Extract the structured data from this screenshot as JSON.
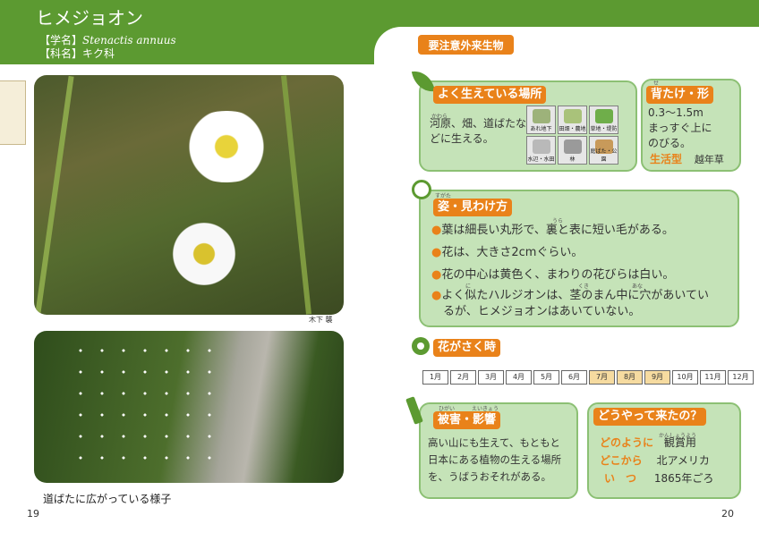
{
  "header": {
    "title": "ヒメジョオン",
    "sci_label": "【学名】",
    "sci_name": "Stenactis annuus",
    "family_label": "【科名】",
    "family_name": "キク科"
  },
  "left": {
    "photo_credit": "木下 襲",
    "caption": "道ばたに広がっている様子",
    "page_number": "19"
  },
  "right": {
    "page_number": "20",
    "badge": "要注意外来生物",
    "habitat": {
      "title": "よく生えている場所",
      "text_line1": "河原、畑、道ばたな",
      "text_line2": "どに生える。",
      "furigana": "かわら",
      "icons": [
        {
          "name": "あれ地下",
          "color": "#9db27a"
        },
        {
          "name": "田畑・農地",
          "color": "#a9c27a"
        },
        {
          "name": "草地・堤防",
          "color": "#6fae4a"
        },
        {
          "name": "水辺・水田",
          "color": "#b9b9b9"
        },
        {
          "name": "林",
          "color": "#9a9a9a"
        },
        {
          "name": "庭ばた・公園",
          "color": "#c89a5a"
        }
      ]
    },
    "height": {
      "title": "背たけ・形",
      "furigana": "せ",
      "line1": "0.3〜1.5m",
      "line2": "まっすぐ上に",
      "line3": "のびる。",
      "lifecycle_label": "生活型",
      "lifecycle_value": "越年草"
    },
    "appearance": {
      "title": "姿・見わけ方",
      "furigana": "すがた",
      "bullets": [
        "葉は細長い丸形で、裏と表に短い毛がある。",
        "花は、大きさ2cmぐらい。",
        "花の中心は黄色く、まわりの花びらは白い。",
        "よく似たハルジオンは、茎のまん中に穴があいてい",
        "るが、ヒメジョオンはあいていない。"
      ],
      "furi_ura": "うら",
      "furi_ni": "に",
      "furi_kuki": "くき",
      "furi_ana": "あな"
    },
    "bloom": {
      "title": "花がさく時",
      "months": [
        "1月",
        "2月",
        "3月",
        "4月",
        "5月",
        "6月",
        "7月",
        "8月",
        "9月",
        "10月",
        "11月",
        "12月"
      ],
      "highlight": [
        7,
        8,
        9
      ]
    },
    "damage": {
      "title": "被害・影響",
      "furigana1": "ひがい",
      "furigana2": "えいきょう",
      "line1": "高い山にも生えて、もともと",
      "line2": "日本にある植物の生える場所",
      "line3": "を、うばうおそれがある。"
    },
    "origin": {
      "title": "どうやって来たの？",
      "how_label": "どのように",
      "how_value": "観賞用",
      "how_furi": "かんしょうよう",
      "where_label": "どこから",
      "where_value": "北アメリカ",
      "when_label": "い　つ",
      "when_value": "1865年ごろ"
    }
  }
}
